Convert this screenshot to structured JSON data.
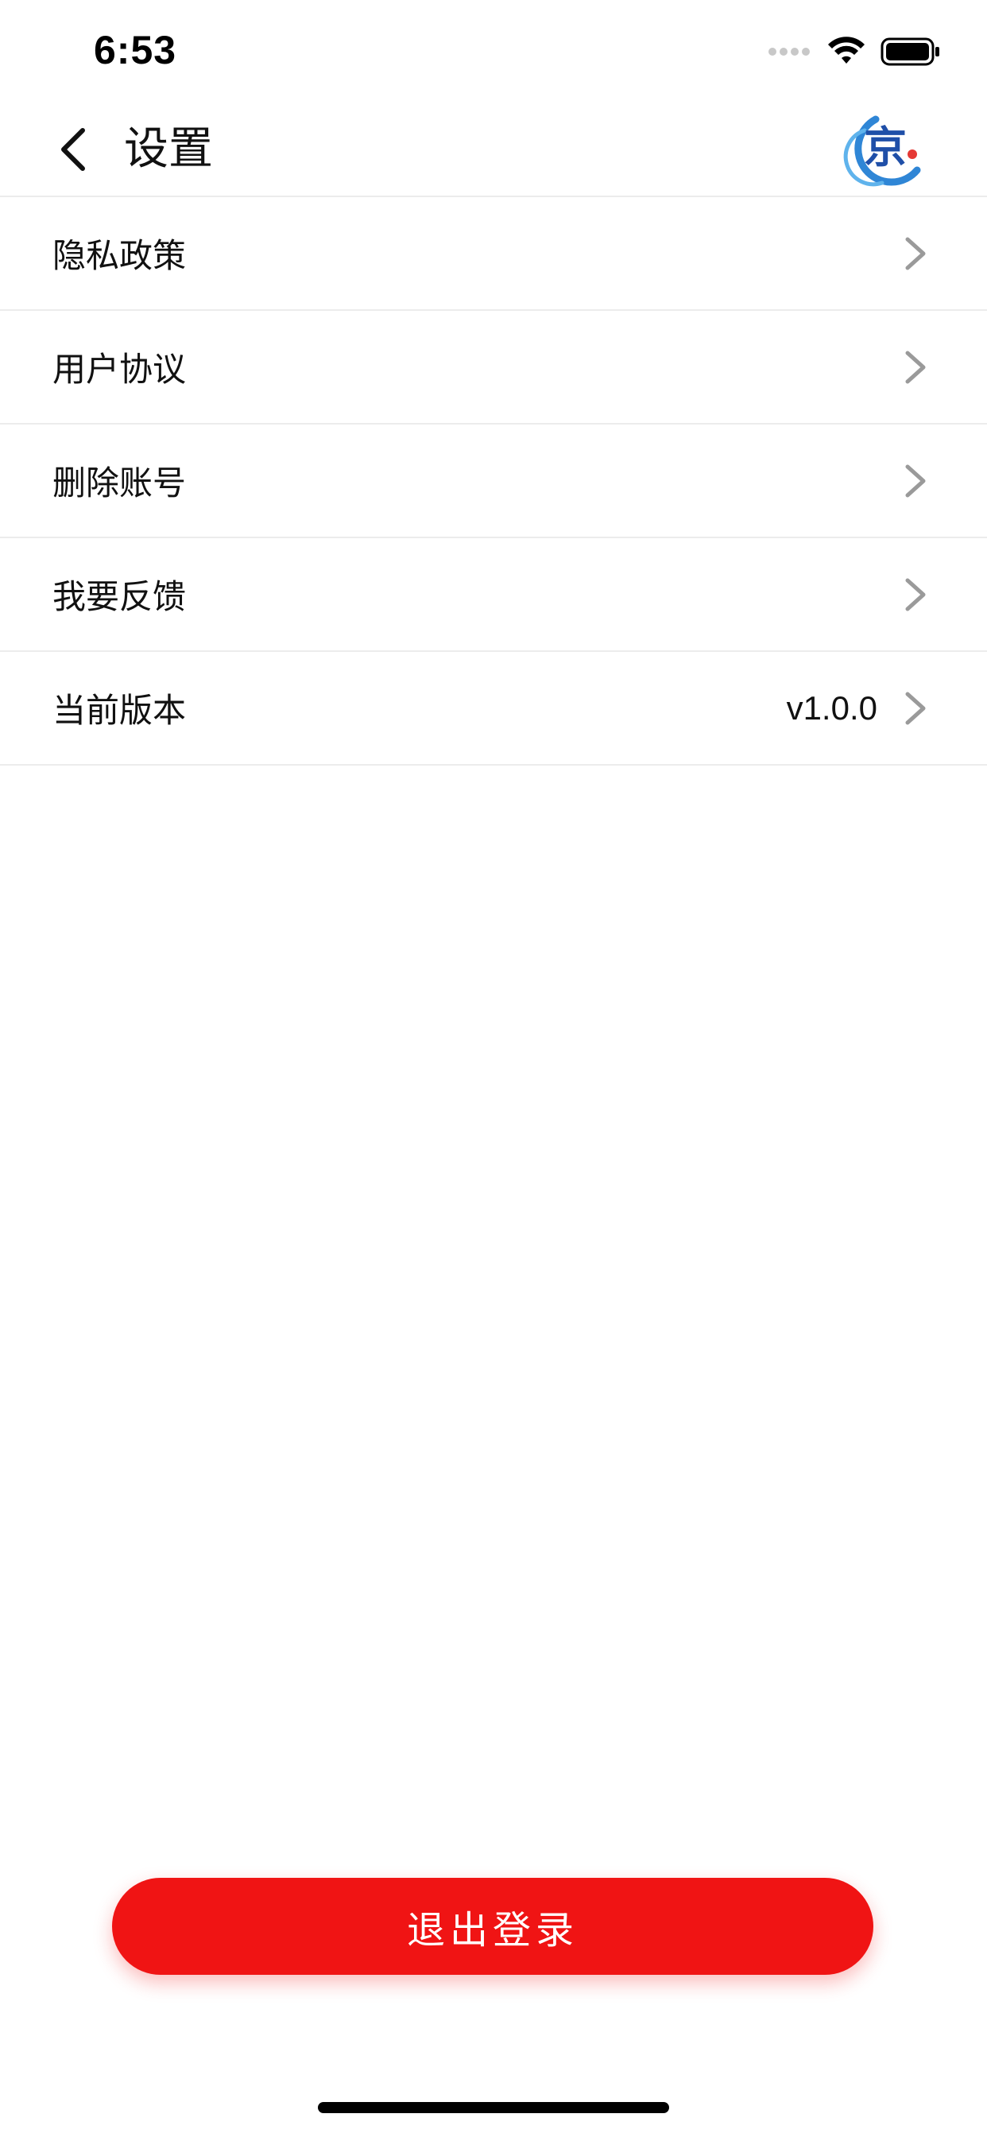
{
  "status_bar": {
    "time": "6:53"
  },
  "nav": {
    "title": "设置",
    "logo_char": "京"
  },
  "settings": {
    "items": [
      {
        "label": "隐私政策",
        "value": ""
      },
      {
        "label": "用户协议",
        "value": ""
      },
      {
        "label": "删除账号",
        "value": ""
      },
      {
        "label": "我要反馈",
        "value": ""
      },
      {
        "label": "当前版本",
        "value": "v1.0.0"
      }
    ]
  },
  "logout": {
    "label": "退出登录"
  },
  "colors": {
    "accent": "#f01414",
    "chevron": "#9a9a9a",
    "divider": "#ececec",
    "logo_blue": "#1f5fbf",
    "logo_red": "#e53935"
  },
  "icons": {
    "back": "chevron-left-icon",
    "row": "chevron-right-icon",
    "wifi": "wifi-icon",
    "battery": "battery-icon",
    "signal": "signal-dots-icon"
  }
}
